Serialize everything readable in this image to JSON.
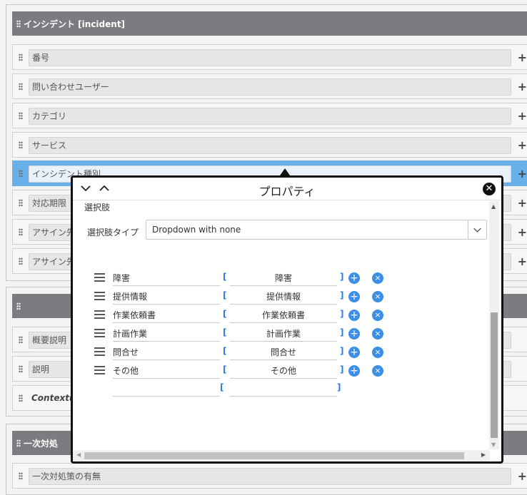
{
  "sections": {
    "incident": {
      "title": "インシデント [incident]"
    },
    "untitled": {
      "title": ""
    },
    "first_response": {
      "title": "一次対処"
    }
  },
  "fields": {
    "number": "番号",
    "inquiry_user": "問い合わせユーザー",
    "category": "カテゴリ",
    "service": "サービス",
    "incident_type": "インシデント種別",
    "deadline": "対応期限",
    "assignee_1": "アサイン先",
    "assignee_2": "アサイン先",
    "summary": "概要説明",
    "description": "説明",
    "contextual": "Contextual",
    "first_response_exists": "一次対処策の有無"
  },
  "dialog": {
    "title": "プロパティ",
    "section_label": "選択肢",
    "choice_type_label": "選択肢タイプ",
    "choice_type_value": "Dropdown with none",
    "options": [
      {
        "label": "障害",
        "value": "障害"
      },
      {
        "label": "提供情報",
        "value": "提供情報"
      },
      {
        "label": "作業依頼書",
        "value": "作業依頼書"
      },
      {
        "label": "計画作業",
        "value": "計画作業"
      },
      {
        "label": "問合せ",
        "value": "問合せ"
      },
      {
        "label": "その他",
        "value": "その他"
      }
    ],
    "bracket_open": "[",
    "bracket_close": "]",
    "add_symbol": "+",
    "remove_symbol": "×"
  },
  "icons": {
    "drag": "drag-handle-icon",
    "add": "plus-icon",
    "close": "close-icon",
    "chevron_down": "chevron-down-icon",
    "chevron_up": "chevron-up-icon",
    "hamburger": "reorder-icon"
  },
  "colors": {
    "section_header": "#7b7c80",
    "active_row": "#6ab0e8",
    "accent": "#3d8ee6"
  }
}
